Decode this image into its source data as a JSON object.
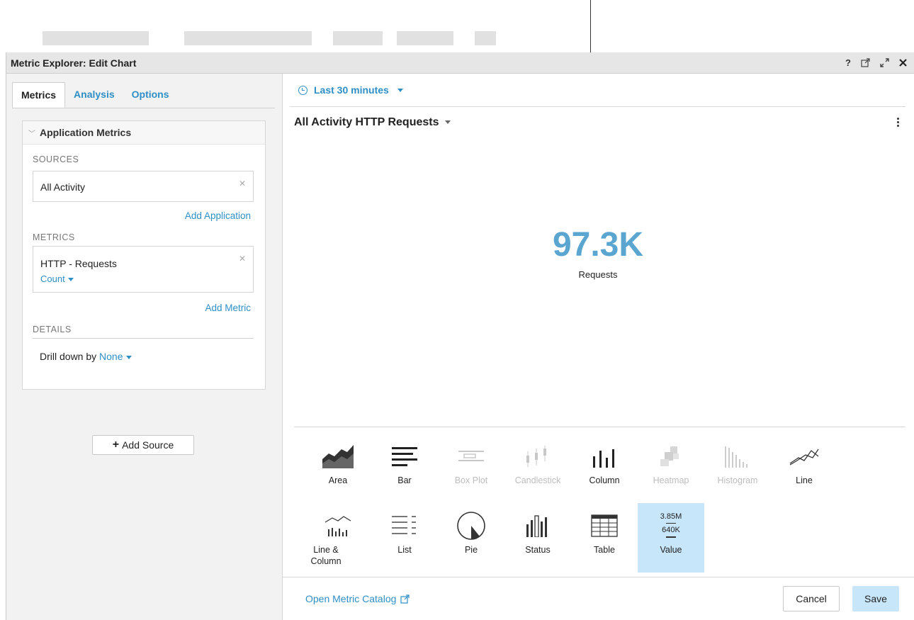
{
  "window": {
    "title": "Metric Explorer: Edit Chart",
    "controls": [
      "?",
      "external-link",
      "expand",
      "close"
    ]
  },
  "tabs": [
    {
      "label": "Metrics",
      "active": true
    },
    {
      "label": "Analysis",
      "active": false
    },
    {
      "label": "Options",
      "active": false
    }
  ],
  "application": {
    "header": "Application Metrics",
    "sources_label": "SOURCES",
    "source_value": "All Activity",
    "add_application": "Add Application",
    "metrics_label": "METRICS",
    "metric_value": "HTTP - Requests",
    "metric_agg": "Count",
    "add_metric": "Add Metric",
    "details_label": "DETAILS",
    "drill_label": "Drill down by",
    "drill_value": "None"
  },
  "add_source": "Add Source",
  "time_range": "Last 30 minutes",
  "chart": {
    "title": "All Activity HTTP Requests",
    "value": "97.3K",
    "unit": "Requests"
  },
  "chart_types": [
    {
      "label": "Area",
      "icon": "area-chart-icon",
      "enabled": true
    },
    {
      "label": "Bar",
      "icon": "bar-chart-icon",
      "enabled": true
    },
    {
      "label": "Box Plot",
      "icon": "box-plot-icon",
      "enabled": false
    },
    {
      "label": "Candlestick",
      "icon": "candlestick-icon",
      "enabled": false
    },
    {
      "label": "Column",
      "icon": "column-chart-icon",
      "enabled": true
    },
    {
      "label": "Heatmap",
      "icon": "heatmap-icon",
      "enabled": false
    },
    {
      "label": "Histogram",
      "icon": "histogram-icon",
      "enabled": false
    },
    {
      "label": "Line",
      "icon": "line-chart-icon",
      "enabled": true
    },
    {
      "label": "Line & Column",
      "icon": "line-column-icon",
      "enabled": true
    },
    {
      "label": "List",
      "icon": "list-icon",
      "enabled": true
    },
    {
      "label": "Pie",
      "icon": "pie-chart-icon",
      "enabled": true
    },
    {
      "label": "Status",
      "icon": "status-icon",
      "enabled": true
    },
    {
      "label": "Table",
      "icon": "table-icon",
      "enabled": true
    },
    {
      "label": "Value",
      "icon": "value-icon",
      "enabled": true,
      "selected": true
    }
  ],
  "value_icon": {
    "top": "3.85M",
    "bottom": "640K"
  },
  "footer": {
    "catalog_link": "Open Metric Catalog",
    "cancel": "Cancel",
    "save": "Save"
  },
  "colors": {
    "accent": "#2e8fc6",
    "value": "#5ba6d0",
    "selected": "#c8e6fa"
  }
}
